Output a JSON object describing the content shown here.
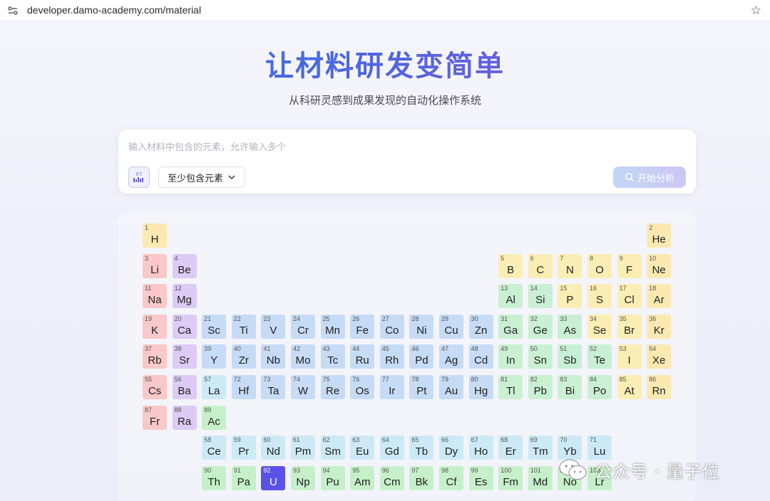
{
  "browser": {
    "url": "developer.damo-academy.com/material"
  },
  "hero": {
    "title": "让材料研发变简单",
    "subtitle": "从科研灵感到成果发现的自动化操作系统"
  },
  "search": {
    "placeholder": "输入材料中包含的元素，允许输入多个",
    "pt_icon_label": "P.T",
    "mode_label": "至少包含元素",
    "start_label": "开始分析"
  },
  "colors": {
    "alkali": "#f9c8c8",
    "alkaline_earth": "#dccbf4",
    "hydrogen_noble": "#fbe9b0",
    "nonmetal": "#fbeeb4",
    "halogen": "#fbeeb4",
    "metalloid": "#c9efd4",
    "post_transition": "#caf0d2",
    "transition": "#c6dbf5",
    "lanthanide": "#cce9f6",
    "actinide": "#c6f0c9",
    "selected": "#5a52e8"
  },
  "periodic_table": {
    "selected": [
      92
    ],
    "elements": [
      {
        "n": 1,
        "s": "H",
        "row": 1,
        "col": 1,
        "cat": "hydrogen_noble"
      },
      {
        "n": 2,
        "s": "He",
        "row": 1,
        "col": 18,
        "cat": "hydrogen_noble"
      },
      {
        "n": 3,
        "s": "Li",
        "row": 2,
        "col": 1,
        "cat": "alkali"
      },
      {
        "n": 4,
        "s": "Be",
        "row": 2,
        "col": 2,
        "cat": "alkaline_earth"
      },
      {
        "n": 5,
        "s": "B",
        "row": 2,
        "col": 13,
        "cat": "nonmetal"
      },
      {
        "n": 6,
        "s": "C",
        "row": 2,
        "col": 14,
        "cat": "nonmetal"
      },
      {
        "n": 7,
        "s": "N",
        "row": 2,
        "col": 15,
        "cat": "nonmetal"
      },
      {
        "n": 8,
        "s": "O",
        "row": 2,
        "col": 16,
        "cat": "nonmetal"
      },
      {
        "n": 9,
        "s": "F",
        "row": 2,
        "col": 17,
        "cat": "halogen"
      },
      {
        "n": 10,
        "s": "Ne",
        "row": 2,
        "col": 18,
        "cat": "hydrogen_noble"
      },
      {
        "n": 11,
        "s": "Na",
        "row": 3,
        "col": 1,
        "cat": "alkali"
      },
      {
        "n": 12,
        "s": "Mg",
        "row": 3,
        "col": 2,
        "cat": "alkaline_earth"
      },
      {
        "n": 13,
        "s": "Al",
        "row": 3,
        "col": 13,
        "cat": "post_transition"
      },
      {
        "n": 14,
        "s": "Si",
        "row": 3,
        "col": 14,
        "cat": "metalloid"
      },
      {
        "n": 15,
        "s": "P",
        "row": 3,
        "col": 15,
        "cat": "nonmetal"
      },
      {
        "n": 16,
        "s": "S",
        "row": 3,
        "col": 16,
        "cat": "nonmetal"
      },
      {
        "n": 17,
        "s": "Cl",
        "row": 3,
        "col": 17,
        "cat": "halogen"
      },
      {
        "n": 18,
        "s": "Ar",
        "row": 3,
        "col": 18,
        "cat": "hydrogen_noble"
      },
      {
        "n": 19,
        "s": "K",
        "row": 4,
        "col": 1,
        "cat": "alkali"
      },
      {
        "n": 20,
        "s": "Ca",
        "row": 4,
        "col": 2,
        "cat": "alkaline_earth"
      },
      {
        "n": 21,
        "s": "Sc",
        "row": 4,
        "col": 3,
        "cat": "transition"
      },
      {
        "n": 22,
        "s": "Ti",
        "row": 4,
        "col": 4,
        "cat": "transition"
      },
      {
        "n": 23,
        "s": "V",
        "row": 4,
        "col": 5,
        "cat": "transition"
      },
      {
        "n": 24,
        "s": "Cr",
        "row": 4,
        "col": 6,
        "cat": "transition"
      },
      {
        "n": 25,
        "s": "Mn",
        "row": 4,
        "col": 7,
        "cat": "transition"
      },
      {
        "n": 26,
        "s": "Fe",
        "row": 4,
        "col": 8,
        "cat": "transition"
      },
      {
        "n": 27,
        "s": "Co",
        "row": 4,
        "col": 9,
        "cat": "transition"
      },
      {
        "n": 28,
        "s": "Ni",
        "row": 4,
        "col": 10,
        "cat": "transition"
      },
      {
        "n": 29,
        "s": "Cu",
        "row": 4,
        "col": 11,
        "cat": "transition"
      },
      {
        "n": 30,
        "s": "Zn",
        "row": 4,
        "col": 12,
        "cat": "transition"
      },
      {
        "n": 31,
        "s": "Ga",
        "row": 4,
        "col": 13,
        "cat": "post_transition"
      },
      {
        "n": 32,
        "s": "Ge",
        "row": 4,
        "col": 14,
        "cat": "metalloid"
      },
      {
        "n": 33,
        "s": "As",
        "row": 4,
        "col": 15,
        "cat": "metalloid"
      },
      {
        "n": 34,
        "s": "Se",
        "row": 4,
        "col": 16,
        "cat": "nonmetal"
      },
      {
        "n": 35,
        "s": "Br",
        "row": 4,
        "col": 17,
        "cat": "halogen"
      },
      {
        "n": 36,
        "s": "Kr",
        "row": 4,
        "col": 18,
        "cat": "hydrogen_noble"
      },
      {
        "n": 37,
        "s": "Rb",
        "row": 5,
        "col": 1,
        "cat": "alkali"
      },
      {
        "n": 38,
        "s": "Sr",
        "row": 5,
        "col": 2,
        "cat": "alkaline_earth"
      },
      {
        "n": 39,
        "s": "Y",
        "row": 5,
        "col": 3,
        "cat": "transition"
      },
      {
        "n": 40,
        "s": "Zr",
        "row": 5,
        "col": 4,
        "cat": "transition"
      },
      {
        "n": 41,
        "s": "Nb",
        "row": 5,
        "col": 5,
        "cat": "transition"
      },
      {
        "n": 42,
        "s": "Mo",
        "row": 5,
        "col": 6,
        "cat": "transition"
      },
      {
        "n": 43,
        "s": "Tc",
        "row": 5,
        "col": 7,
        "cat": "transition"
      },
      {
        "n": 44,
        "s": "Ru",
        "row": 5,
        "col": 8,
        "cat": "transition"
      },
      {
        "n": 45,
        "s": "Rh",
        "row": 5,
        "col": 9,
        "cat": "transition"
      },
      {
        "n": 46,
        "s": "Pd",
        "row": 5,
        "col": 10,
        "cat": "transition"
      },
      {
        "n": 47,
        "s": "Ag",
        "row": 5,
        "col": 11,
        "cat": "transition"
      },
      {
        "n": 48,
        "s": "Cd",
        "row": 5,
        "col": 12,
        "cat": "transition"
      },
      {
        "n": 49,
        "s": "In",
        "row": 5,
        "col": 13,
        "cat": "post_transition"
      },
      {
        "n": 50,
        "s": "Sn",
        "row": 5,
        "col": 14,
        "cat": "post_transition"
      },
      {
        "n": 51,
        "s": "Sb",
        "row": 5,
        "col": 15,
        "cat": "metalloid"
      },
      {
        "n": 52,
        "s": "Te",
        "row": 5,
        "col": 16,
        "cat": "metalloid"
      },
      {
        "n": 53,
        "s": "I",
        "row": 5,
        "col": 17,
        "cat": "halogen"
      },
      {
        "n": 54,
        "s": "Xe",
        "row": 5,
        "col": 18,
        "cat": "hydrogen_noble"
      },
      {
        "n": 55,
        "s": "Cs",
        "row": 6,
        "col": 1,
        "cat": "alkali"
      },
      {
        "n": 56,
        "s": "Ba",
        "row": 6,
        "col": 2,
        "cat": "alkaline_earth"
      },
      {
        "n": 57,
        "s": "La",
        "row": 6,
        "col": 3,
        "cat": "lanthanide"
      },
      {
        "n": 72,
        "s": "Hf",
        "row": 6,
        "col": 4,
        "cat": "transition"
      },
      {
        "n": 73,
        "s": "Ta",
        "row": 6,
        "col": 5,
        "cat": "transition"
      },
      {
        "n": 74,
        "s": "W",
        "row": 6,
        "col": 6,
        "cat": "transition"
      },
      {
        "n": 75,
        "s": "Re",
        "row": 6,
        "col": 7,
        "cat": "transition"
      },
      {
        "n": 76,
        "s": "Os",
        "row": 6,
        "col": 8,
        "cat": "transition"
      },
      {
        "n": 77,
        "s": "Ir",
        "row": 6,
        "col": 9,
        "cat": "transition"
      },
      {
        "n": 78,
        "s": "Pt",
        "row": 6,
        "col": 10,
        "cat": "transition"
      },
      {
        "n": 79,
        "s": "Au",
        "row": 6,
        "col": 11,
        "cat": "transition"
      },
      {
        "n": 80,
        "s": "Hg",
        "row": 6,
        "col": 12,
        "cat": "transition"
      },
      {
        "n": 81,
        "s": "Tl",
        "row": 6,
        "col": 13,
        "cat": "post_transition"
      },
      {
        "n": 82,
        "s": "Pb",
        "row": 6,
        "col": 14,
        "cat": "post_transition"
      },
      {
        "n": 83,
        "s": "Bi",
        "row": 6,
        "col": 15,
        "cat": "post_transition"
      },
      {
        "n": 84,
        "s": "Po",
        "row": 6,
        "col": 16,
        "cat": "metalloid"
      },
      {
        "n": 85,
        "s": "At",
        "row": 6,
        "col": 17,
        "cat": "halogen"
      },
      {
        "n": 86,
        "s": "Rn",
        "row": 6,
        "col": 18,
        "cat": "hydrogen_noble"
      },
      {
        "n": 87,
        "s": "Fr",
        "row": 7,
        "col": 1,
        "cat": "alkali"
      },
      {
        "n": 88,
        "s": "Ra",
        "row": 7,
        "col": 2,
        "cat": "alkaline_earth"
      },
      {
        "n": 89,
        "s": "Ac",
        "row": 7,
        "col": 3,
        "cat": "actinide"
      },
      {
        "n": 58,
        "s": "Ce",
        "row": 8,
        "col": 3,
        "cat": "lanthanide"
      },
      {
        "n": 59,
        "s": "Pr",
        "row": 8,
        "col": 4,
        "cat": "lanthanide"
      },
      {
        "n": 60,
        "s": "Nd",
        "row": 8,
        "col": 5,
        "cat": "lanthanide"
      },
      {
        "n": 61,
        "s": "Pm",
        "row": 8,
        "col": 6,
        "cat": "lanthanide"
      },
      {
        "n": 62,
        "s": "Sm",
        "row": 8,
        "col": 7,
        "cat": "lanthanide"
      },
      {
        "n": 63,
        "s": "Eu",
        "row": 8,
        "col": 8,
        "cat": "lanthanide"
      },
      {
        "n": 64,
        "s": "Gd",
        "row": 8,
        "col": 9,
        "cat": "lanthanide"
      },
      {
        "n": 65,
        "s": "Tb",
        "row": 8,
        "col": 10,
        "cat": "lanthanide"
      },
      {
        "n": 66,
        "s": "Dy",
        "row": 8,
        "col": 11,
        "cat": "lanthanide"
      },
      {
        "n": 67,
        "s": "Ho",
        "row": 8,
        "col": 12,
        "cat": "lanthanide"
      },
      {
        "n": 68,
        "s": "Er",
        "row": 8,
        "col": 13,
        "cat": "lanthanide"
      },
      {
        "n": 69,
        "s": "Tm",
        "row": 8,
        "col": 14,
        "cat": "lanthanide"
      },
      {
        "n": 70,
        "s": "Yb",
        "row": 8,
        "col": 15,
        "cat": "lanthanide"
      },
      {
        "n": 71,
        "s": "Lu",
        "row": 8,
        "col": 16,
        "cat": "lanthanide"
      },
      {
        "n": 90,
        "s": "Th",
        "row": 9,
        "col": 3,
        "cat": "actinide"
      },
      {
        "n": 91,
        "s": "Pa",
        "row": 9,
        "col": 4,
        "cat": "actinide"
      },
      {
        "n": 92,
        "s": "U",
        "row": 9,
        "col": 5,
        "cat": "actinide"
      },
      {
        "n": 93,
        "s": "Np",
        "row": 9,
        "col": 6,
        "cat": "actinide"
      },
      {
        "n": 94,
        "s": "Pu",
        "row": 9,
        "col": 7,
        "cat": "actinide"
      },
      {
        "n": 95,
        "s": "Am",
        "row": 9,
        "col": 8,
        "cat": "actinide"
      },
      {
        "n": 96,
        "s": "Cm",
        "row": 9,
        "col": 9,
        "cat": "actinide"
      },
      {
        "n": 97,
        "s": "Bk",
        "row": 9,
        "col": 10,
        "cat": "actinide"
      },
      {
        "n": 98,
        "s": "Cf",
        "row": 9,
        "col": 11,
        "cat": "actinide"
      },
      {
        "n": 99,
        "s": "Es",
        "row": 9,
        "col": 12,
        "cat": "actinide"
      },
      {
        "n": 100,
        "s": "Fm",
        "row": 9,
        "col": 13,
        "cat": "actinide"
      },
      {
        "n": 101,
        "s": "Md",
        "row": 9,
        "col": 14,
        "cat": "actinide"
      },
      {
        "n": 102,
        "s": "No",
        "row": 9,
        "col": 15,
        "cat": "actinide"
      },
      {
        "n": 103,
        "s": "Lr",
        "row": 9,
        "col": 16,
        "cat": "actinide"
      }
    ]
  },
  "watermark": {
    "text": "公众号 · 量子位"
  }
}
